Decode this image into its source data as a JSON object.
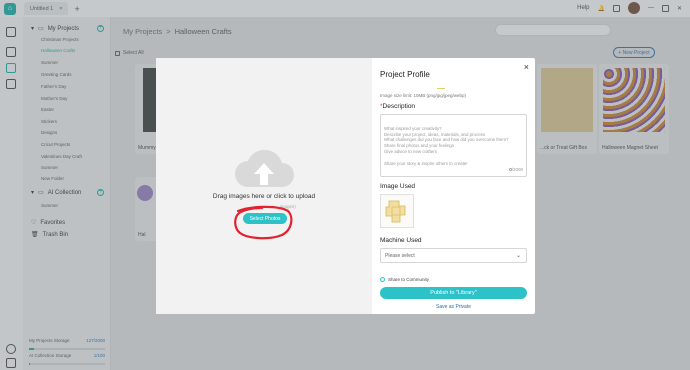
{
  "titlebar": {
    "tab_label": "Untitled 1",
    "tab_close": "×",
    "new_tab": "+",
    "help": "Help"
  },
  "sidebar": {
    "my_projects": "My Projects",
    "project_items": [
      "Christmas Projects",
      "Halloween Crafts",
      "Summer",
      "Greeting Cards",
      "Father's Day",
      "Mother's Day",
      "Easter",
      "Stickers",
      "Designs",
      "Cricut Projects",
      "Valentines Day Craft",
      "Summer",
      "New Folder"
    ],
    "active_index": 1,
    "ai_collection": "AI Collection",
    "ai_items": [
      "Summer"
    ],
    "favorites": "Favorites",
    "trash": "Trash Bin",
    "storage_projects_label": "My Projects Storage",
    "storage_projects_value": "127/2000",
    "storage_projects_fraction": 0.06,
    "storage_ai_label": "AI Collection Storage",
    "storage_ai_value": "1/100",
    "storage_ai_fraction": 0.01
  },
  "main": {
    "breadcrumb_root": "My Projects",
    "breadcrumb_sep": ">",
    "breadcrumb_current": "Halloween Crafts",
    "select_all": "Select All",
    "new_project": "+ New Project",
    "cards": [
      "Mummy",
      "...ck or Treat Gift Box",
      "Halloween Magnet Sheet",
      "Hal"
    ]
  },
  "modal": {
    "close": "×",
    "drag_text": "Drag images here or click to upload",
    "sub_text": "...images)",
    "select_photos": "Select Photos",
    "title": "Project Profile",
    "image_limit": "Image size limit: 10MB (png/jpg/jpeg/webp)",
    "description_label": "Description",
    "required_mark": "*",
    "description_placeholder": "What inspired your creativity?\nDescribe your project, ideas, materials, and process\nWhat challenges did you face and how did you overcome them?\nShare final photos and your feelings\nGive advice to new crafters\n\nShare your story & inspire others to create!",
    "desc_count": "0",
    "desc_max": "/2000",
    "image_used": "Image Used",
    "machine_used": "Machine Used",
    "machine_placeholder": "Please select",
    "share_label": "Share to Community",
    "publish": "Publish to \"Library\"",
    "save_private": "Save as Private"
  },
  "colors": {
    "accent": "#2cc2c8",
    "link": "#2a6ea8",
    "annotation": "#e0232e"
  }
}
